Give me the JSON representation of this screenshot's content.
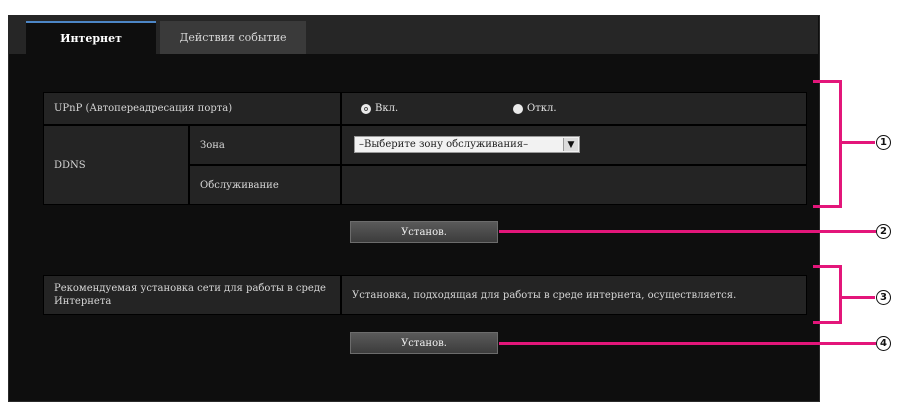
{
  "tabs": [
    {
      "label": "Интернет",
      "active": true
    },
    {
      "label": "Действия событие",
      "active": false
    }
  ],
  "upnp": {
    "label": "UPnP (Автопереадресация порта)",
    "on_label": "Вкл.",
    "off_label": "Откл.",
    "selected": "on"
  },
  "ddns": {
    "label": "DDNS",
    "service_label": "Зона",
    "service_value": "–Выберите зону обслуживания–",
    "maintenance_label": "Обслуживание"
  },
  "set_button_1": "Установ.",
  "recommended": {
    "label": "Рекомендуемая установка сети для работы в среде Интернета",
    "text": "Установка, подходящая для работы в среде интернета, осуществляется."
  },
  "set_button_2": "Установ.",
  "callouts": [
    "1",
    "2",
    "3",
    "4"
  ],
  "accent_color": "#e3167a"
}
